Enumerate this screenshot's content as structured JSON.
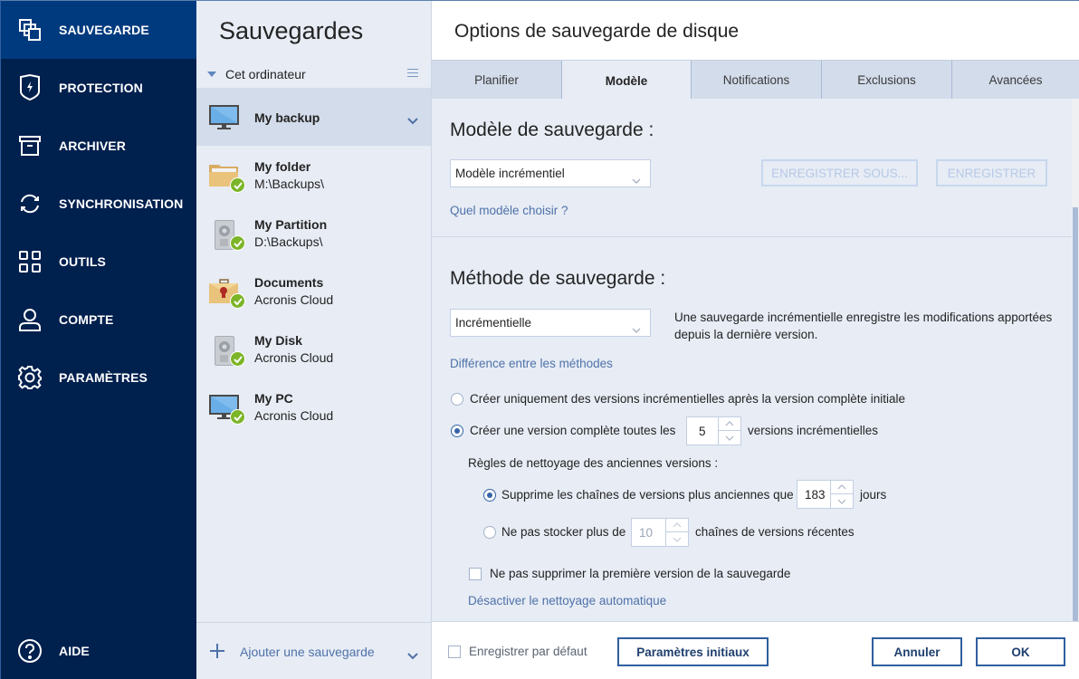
{
  "nav": {
    "items": [
      {
        "label": "SAUVEGARDE",
        "icon": "backup-icon",
        "active": true
      },
      {
        "label": "PROTECTION",
        "icon": "shield-icon",
        "active": false
      },
      {
        "label": "ARCHIVER",
        "icon": "archive-icon",
        "active": false
      },
      {
        "label": "SYNCHRONISATION",
        "icon": "sync-icon",
        "active": false
      },
      {
        "label": "OUTILS",
        "icon": "tools-grid-icon",
        "active": false
      },
      {
        "label": "COMPTE",
        "icon": "user-icon",
        "active": false
      },
      {
        "label": "PARAMÈTRES",
        "icon": "gear-icon",
        "active": false
      }
    ],
    "help": {
      "label": "AIDE",
      "icon": "help-icon"
    }
  },
  "backups": {
    "title": "Sauvegardes",
    "group": "Cet ordinateur",
    "items": [
      {
        "name": "My backup",
        "location": "",
        "icon": "monitor-icon",
        "status": "none",
        "selected": true
      },
      {
        "name": "My folder",
        "location": "M:\\Backups\\",
        "icon": "folder-icon",
        "status": "ok"
      },
      {
        "name": "My Partition",
        "location": "D:\\Backups\\",
        "icon": "disk-icon",
        "status": "ok"
      },
      {
        "name": "Documents",
        "location": "Acronis Cloud",
        "icon": "briefcase-icon",
        "status": "ok"
      },
      {
        "name": "My Disk",
        "location": "Acronis Cloud",
        "icon": "disk-icon",
        "status": "ok"
      },
      {
        "name": "My PC",
        "location": "Acronis Cloud",
        "icon": "monitor-icon",
        "status": "ok"
      }
    ],
    "add_label": "Ajouter une sauvegarde"
  },
  "options": {
    "title": "Options de sauvegarde de disque",
    "tabs": [
      {
        "label": "Planifier",
        "active": false
      },
      {
        "label": "Modèle",
        "active": true
      },
      {
        "label": "Notifications",
        "active": false
      },
      {
        "label": "Exclusions",
        "active": false
      },
      {
        "label": "Avancées",
        "active": false
      }
    ],
    "scheme": {
      "heading": "Modèle de sauvegarde :",
      "selected": "Modèle incrémentiel",
      "save_as_label": "ENREGISTRER SOUS...",
      "save_label": "ENREGISTRER",
      "help_link": "Quel modèle choisir ?"
    },
    "method": {
      "heading": "Méthode de sauvegarde :",
      "selected": "Incrémentielle",
      "description": "Une sauvegarde incrémentielle enregistre les modifications apportées depuis la dernière version.",
      "help_link": "Différence entre les méthodes",
      "option_incremental_only": "Créer uniquement des versions incrémentielles après la version complète initiale",
      "option_full_every_prefix": "Créer une version complète toutes les",
      "option_full_every_value": "5",
      "option_full_every_suffix": "versions incrémentielles",
      "selected_option": "full_every"
    },
    "cleanup": {
      "heading": "Règles de nettoyage des anciennes versions :",
      "delete_older_prefix": "Supprime les chaînes de versions plus anciennes que",
      "delete_older_value": "183",
      "delete_older_suffix": "jours",
      "keep_max_prefix": "Ne pas stocker plus de",
      "keep_max_value": "10",
      "keep_max_suffix": "chaînes de versions récentes",
      "selected_option": "delete_older",
      "keep_first_label": "Ne pas supprimer la première version de la sauvegarde",
      "keep_first_checked": false,
      "disable_link": "Désactiver le nettoyage automatique"
    },
    "footer": {
      "save_default_label": "Enregistrer par défaut",
      "save_default_checked": false,
      "reset_label": "Paramètres initiaux",
      "cancel_label": "Annuler",
      "ok_label": "OK"
    },
    "scroll_position": 0.2
  },
  "colors": {
    "nav_bg": "#00204e",
    "nav_active": "#003a7e",
    "accent": "#2f5f9e",
    "link": "#4f72a8",
    "success": "#7cb528"
  }
}
